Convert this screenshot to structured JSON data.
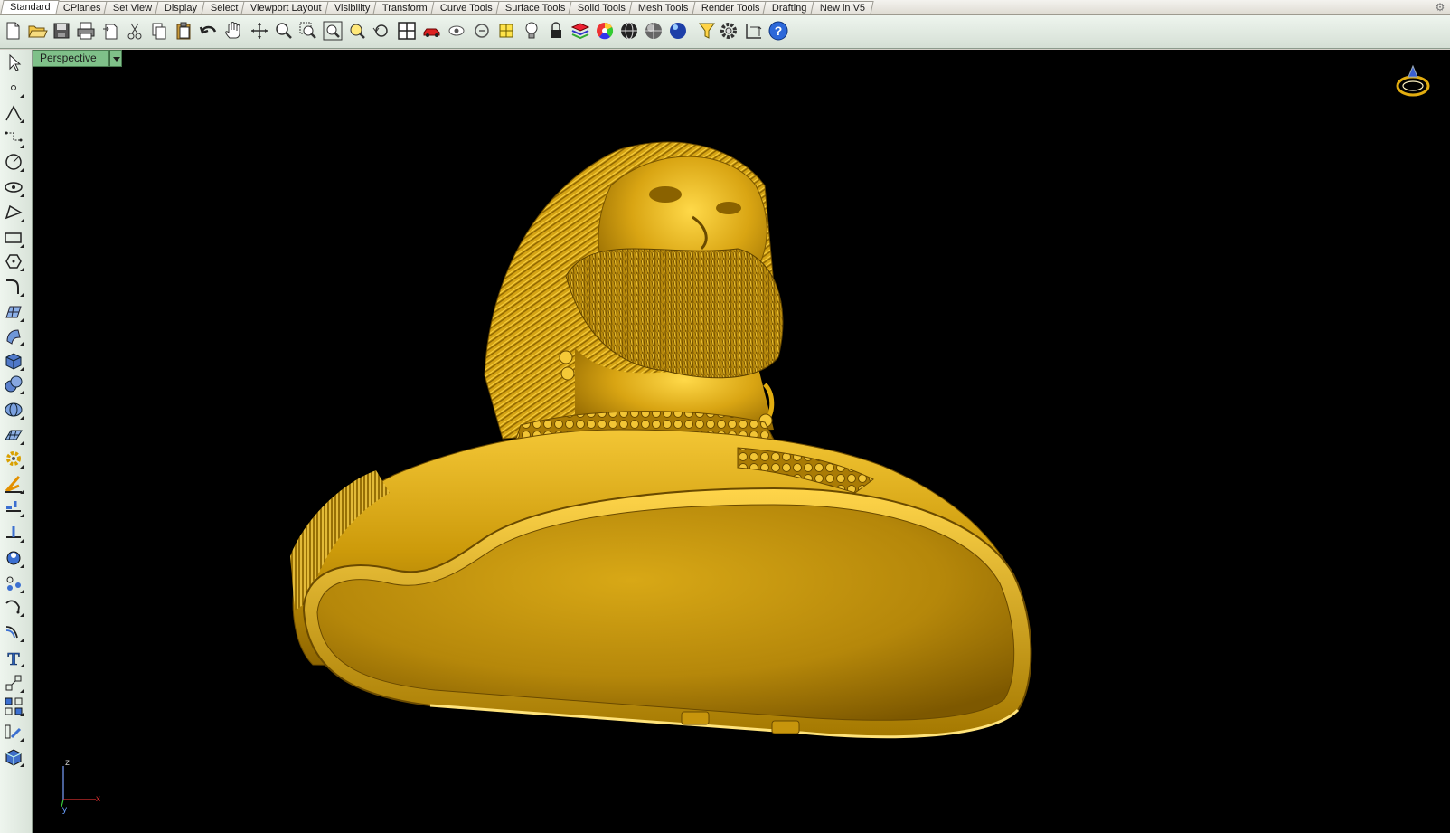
{
  "tabs": [
    {
      "label": "Standard",
      "active": true
    },
    {
      "label": "CPlanes"
    },
    {
      "label": "Set View"
    },
    {
      "label": "Display"
    },
    {
      "label": "Select"
    },
    {
      "label": "Viewport Layout"
    },
    {
      "label": "Visibility"
    },
    {
      "label": "Transform"
    },
    {
      "label": "Curve Tools"
    },
    {
      "label": "Surface Tools"
    },
    {
      "label": "Solid Tools"
    },
    {
      "label": "Mesh Tools"
    },
    {
      "label": "Render Tools"
    },
    {
      "label": "Drafting"
    },
    {
      "label": "New in V5"
    }
  ],
  "toolbar_icons": [
    "new-file-icon",
    "open-folder-icon",
    "save-icon",
    "print-icon",
    "import-icon",
    "cut-icon",
    "copy-icon",
    "paste-icon",
    "undo-icon",
    "pan-hand-icon",
    "rotate-view-icon",
    "zoom-icon",
    "zoom-window-icon",
    "zoom-extents-icon",
    "zoom-selected-icon",
    "undo-view-icon",
    "four-viewports-icon",
    "car-icon",
    "hide-icon",
    "show-icon",
    "grid-snap-icon",
    "light-bulb-icon",
    "lock-icon",
    "layer-icon",
    "color-wheel-icon",
    "wireframe-sphere-icon",
    "shaded-sphere-icon",
    "rendered-sphere-icon",
    "blue-sphere-icon",
    "selection-filter-icon",
    "options-gear-icon",
    "dimension-icon",
    "help-icon"
  ],
  "left_tools": [
    "select-arrow-icon",
    "point-icon",
    "polyline-icon",
    "curve-icon",
    "circle-icon",
    "ellipse-icon",
    "polygon-icon",
    "rectangle-icon",
    "hexagon-icon",
    "fillet-curve-icon",
    "surface-edit-icon",
    "surface-icon",
    "box-solid-icon",
    "boolean-icon",
    "mesh-icon",
    "plane-surface-icon",
    "gear-transform-icon",
    "analyze-icon",
    "trim-icon",
    "split-icon",
    "curve-boolean-icon",
    "points-icon",
    "blend-icon",
    "offset-curve-icon",
    "text-icon",
    "dimension-icon",
    "array-icon",
    "scale-icon",
    "render-box-icon"
  ],
  "viewport": {
    "title": "Perspective",
    "model_color": "#e2ad10"
  },
  "axes": {
    "z": "z",
    "x": "x",
    "y": "y"
  },
  "colors": {
    "viewport_bg": "#000000",
    "viewport_tab": "#7fc089",
    "toolbar_bg": "#e3ece3"
  }
}
